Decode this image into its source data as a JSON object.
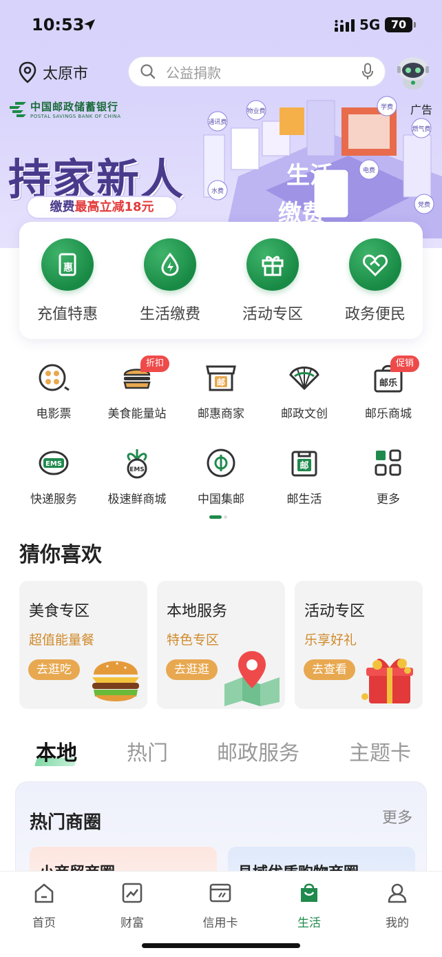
{
  "status_bar": {
    "time": "10:53",
    "network": "5G",
    "battery": "70"
  },
  "header": {
    "location": "太原市",
    "search_placeholder": "公益捐款"
  },
  "banner": {
    "bank_name_cn": "中国邮政储蓄银行",
    "bank_name_en": "POSTAL SAVINGS BANK OF CHINA",
    "ad_label": "广告",
    "title": "持家新人",
    "pill_prefix": "缴费",
    "pill_highlight": "最高立减18元",
    "city_labels": [
      "通讯费",
      "物业费",
      "学费",
      "燃气费",
      "水费",
      "电费",
      "党费",
      "生活",
      "缴费"
    ],
    "colors": {
      "title": "#4a3a8c",
      "accent": "#e33b3b"
    }
  },
  "quick_actions": [
    {
      "label": "充值特惠",
      "icon": "recharge-discount-icon"
    },
    {
      "label": "生活缴费",
      "icon": "utility-payment-icon"
    },
    {
      "label": "活动专区",
      "icon": "gift-icon"
    },
    {
      "label": "政务便民",
      "icon": "handshake-heart-icon"
    }
  ],
  "services": [
    {
      "label": "电影票",
      "icon": "film-reel-icon"
    },
    {
      "label": "美食能量站",
      "icon": "burger-icon",
      "tag": "折扣"
    },
    {
      "label": "邮惠商家",
      "icon": "shop-icon",
      "glyph": "邮"
    },
    {
      "label": "邮政文创",
      "icon": "fan-icon"
    },
    {
      "label": "邮乐商城",
      "icon": "shopping-bag-icon",
      "glyph": "邮乐",
      "tag": "促销"
    },
    {
      "label": "快递服务",
      "icon": "ems-icon",
      "glyph": "EMS"
    },
    {
      "label": "极速鲜商城",
      "icon": "ems-fresh-icon",
      "glyph": "EMS"
    },
    {
      "label": "中国集邮",
      "icon": "philately-icon"
    },
    {
      "label": "邮生活",
      "icon": "post-life-icon",
      "glyph": "邮"
    },
    {
      "label": "更多",
      "icon": "grid-more-icon"
    }
  ],
  "guess": {
    "title": "猜你喜欢",
    "cards": [
      {
        "title": "美食专区",
        "subtitle": "超值能量餐",
        "button": "去逛吃",
        "image": "burger-image"
      },
      {
        "title": "本地服务",
        "subtitle": "特色专区",
        "button": "去逛逛",
        "image": "map-pin-image"
      },
      {
        "title": "活动专区",
        "subtitle": "乐享好礼",
        "button": "去查看",
        "image": "gift-box-image"
      }
    ]
  },
  "tabs": [
    "本地",
    "热门",
    "邮政服务",
    "主题卡"
  ],
  "hot_district": {
    "title": "热门商圈",
    "more": "更多",
    "cards": [
      "小商贸商圈",
      "县域优质购物商圈"
    ]
  },
  "bottom_nav": [
    {
      "label": "首页",
      "icon": "home-icon"
    },
    {
      "label": "财富",
      "icon": "chart-icon"
    },
    {
      "label": "信用卡",
      "icon": "credit-card-icon"
    },
    {
      "label": "生活",
      "icon": "shopping-bag-icon",
      "active": true
    },
    {
      "label": "我的",
      "icon": "user-icon"
    }
  ],
  "theme": {
    "green": "#1f8a4c",
    "orange": "#e8a850",
    "red": "#ef4a4a"
  }
}
